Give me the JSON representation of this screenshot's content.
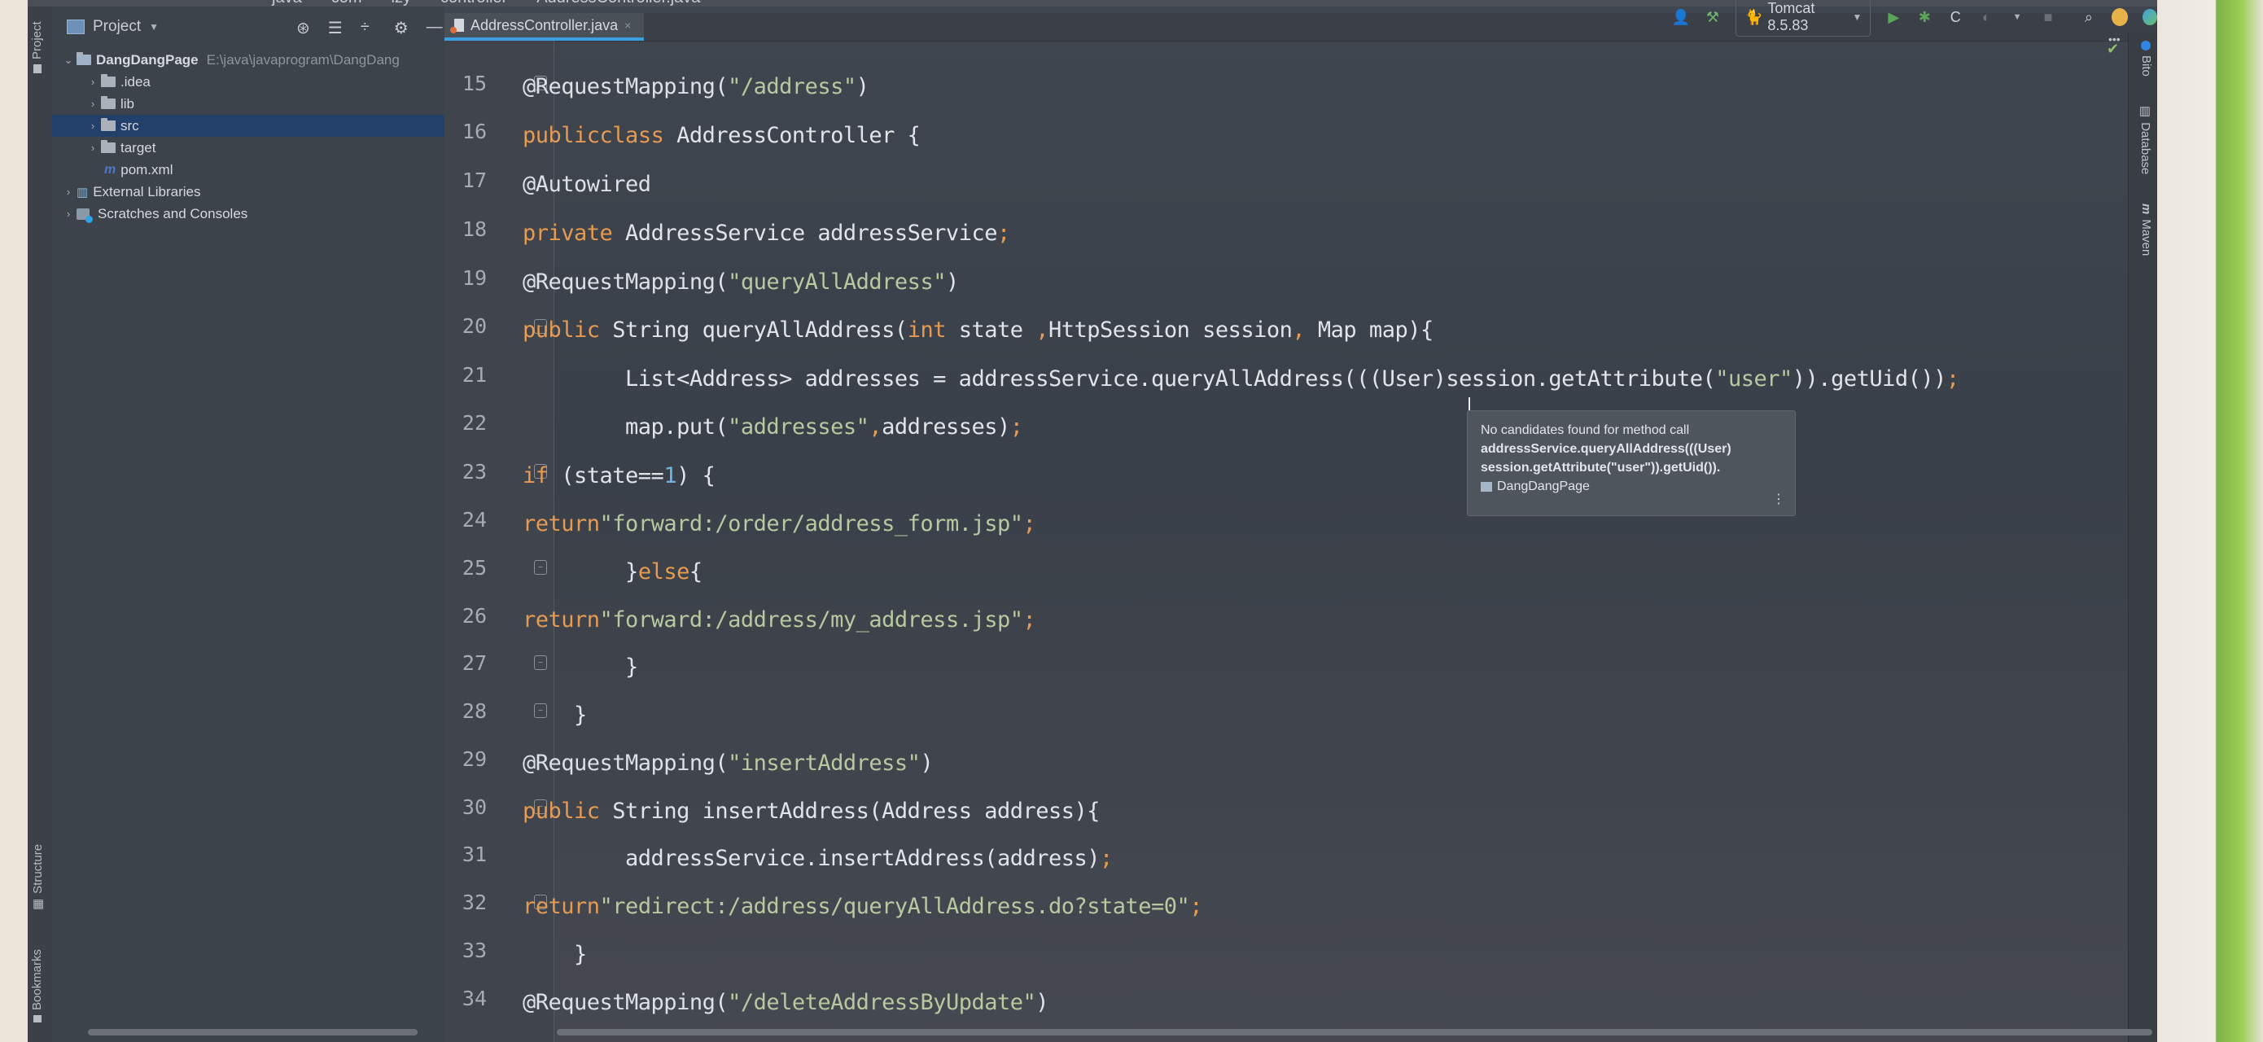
{
  "breadcrumb": [
    "java",
    "com",
    "lzy",
    "controller",
    "AddressController.java"
  ],
  "left_stripe": {
    "project_label": "Project",
    "structure_label": "Structure",
    "bookmarks_label": "Bookmarks"
  },
  "project_panel": {
    "title": "Project",
    "tree": [
      {
        "label": "DangDangPage",
        "hint": "E:\\java\\javaprogram\\DangDang",
        "expanded": true,
        "type": "module"
      },
      {
        "label": ".idea",
        "type": "folder"
      },
      {
        "label": "lib",
        "type": "folder"
      },
      {
        "label": "src",
        "type": "folder",
        "selected": true
      },
      {
        "label": "target",
        "type": "folder"
      },
      {
        "label": "pom.xml",
        "type": "maven-file"
      },
      {
        "label": "External Libraries",
        "type": "libraries"
      },
      {
        "label": "Scratches and Consoles",
        "type": "scratches"
      }
    ]
  },
  "editor": {
    "tab": {
      "label": "AddressController.java",
      "active": true
    },
    "lines": [
      {
        "num": "15",
        "text": "@RequestMapping(\"/address\")"
      },
      {
        "num": "16",
        "text": "public class AddressController {"
      },
      {
        "num": "17",
        "text": "    @Autowired"
      },
      {
        "num": "18",
        "text": "    private AddressService addressService;"
      },
      {
        "num": "19",
        "text": "    @RequestMapping(\"queryAllAddress\")"
      },
      {
        "num": "20",
        "text": "    public String queryAllAddress(int state ,HttpSession session, Map map){"
      },
      {
        "num": "21",
        "text": "        List<Address> addresses = addressService.queryAllAddress(((User)session.getAttribute(\"user\")).getUid());"
      },
      {
        "num": "22",
        "text": "        map.put(\"addresses\",addresses);"
      },
      {
        "num": "23",
        "text": "        if (state==1) {"
      },
      {
        "num": "24",
        "text": "            return \"forward:/order/address_form.jsp\";"
      },
      {
        "num": "25",
        "text": "        }else{"
      },
      {
        "num": "26",
        "text": "            return \"forward:/address/my_address.jsp\";"
      },
      {
        "num": "27",
        "text": "        }"
      },
      {
        "num": "28",
        "text": "    }"
      },
      {
        "num": "29",
        "text": "    @RequestMapping(\"insertAddress\")"
      },
      {
        "num": "30",
        "text": "    public String insertAddress(Address address){"
      },
      {
        "num": "31",
        "text": "        addressService.insertAddress(address);"
      },
      {
        "num": "32",
        "text": "        return \"redirect:/address/queryAllAddress.do?state=0\";"
      },
      {
        "num": "33",
        "text": "    }"
      },
      {
        "num": "34",
        "text": "    @RequestMapping(\"/deleteAddressByUpdate\")"
      }
    ]
  },
  "tooltip": {
    "message": "No candidates found for method call",
    "call_line1": "addressService.queryAllAddress(((User)",
    "call_line2": "session.getAttribute(\"user\")).getUid()).",
    "project": "DangDangPage",
    "more_icon": "more-vertical-icon"
  },
  "toolbar": {
    "run_config": "Tomcat 8.5.83",
    "icons": [
      "user-icon",
      "build-hammer-icon",
      "run-icon",
      "debug-icon",
      "coverage-icon",
      "stop-icon",
      "search-icon",
      "update-icon",
      "plugin-icon"
    ]
  },
  "right_stripe": {
    "bito_label": "Bito",
    "database_label": "Database",
    "maven_label": "Maven"
  },
  "colors": {
    "keyword": "#e69a52",
    "string": "#b8c9a0",
    "number": "#6fb5e0",
    "selection": "#23406a",
    "tab_underline": "#3d9ee0"
  }
}
